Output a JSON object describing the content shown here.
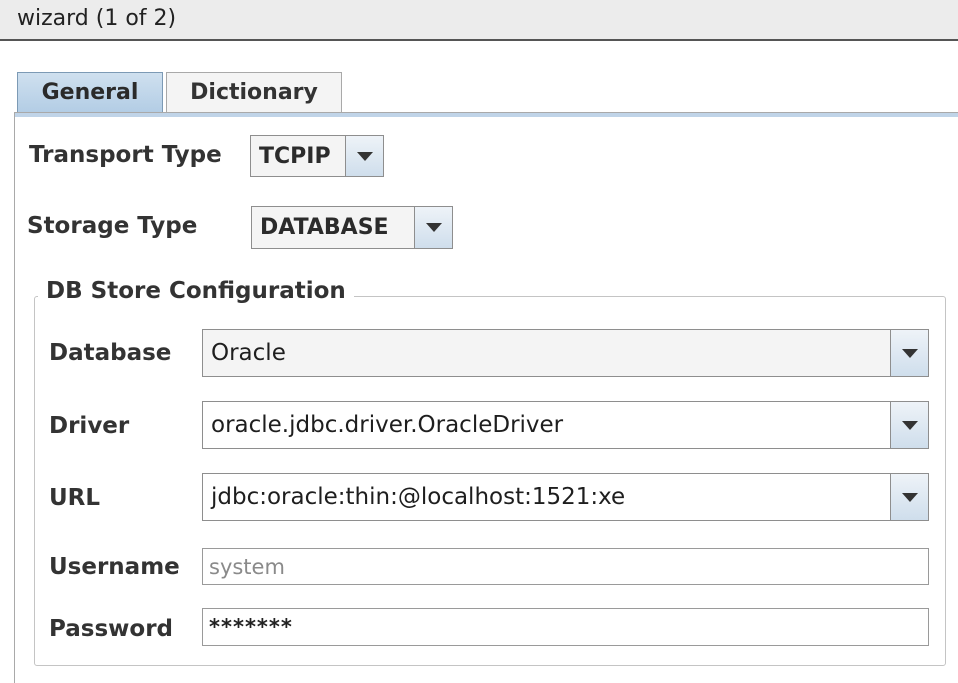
{
  "window": {
    "title": "wizard (1 of 2)"
  },
  "tabs": [
    {
      "label": "General",
      "selected": true
    },
    {
      "label": "Dictionary",
      "selected": false
    }
  ],
  "general": {
    "transport_type": {
      "label": "Transport Type",
      "value": "TCPIP"
    },
    "storage_type": {
      "label": "Storage Type",
      "value": "DATABASE"
    }
  },
  "db_store": {
    "legend": "DB Store Configuration",
    "database": {
      "label": "Database",
      "value": "Oracle"
    },
    "driver": {
      "label": "Driver",
      "value": "oracle.jdbc.driver.OracleDriver"
    },
    "url": {
      "label": "URL",
      "value": "jdbc:oracle:thin:@localhost:1521:xe"
    },
    "username": {
      "label": "Username",
      "value": "system"
    },
    "password": {
      "label": "Password",
      "value": "*******"
    }
  },
  "icons": {
    "dropdown": "chevron-down-icon"
  },
  "colors": {
    "tab_selected": "#b3cde5",
    "header_bg": "#ececec",
    "combo_button": "#cfdeec"
  }
}
